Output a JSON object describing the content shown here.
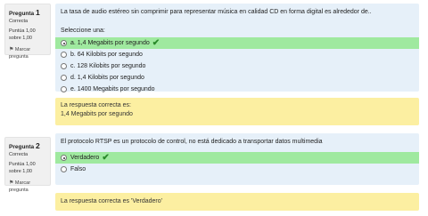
{
  "questions": [
    {
      "label": "Pregunta",
      "number": "1",
      "state": "Correcta",
      "grade": "Puntúa 1,00 sobre 1,00",
      "flag_label": "Marcar pregunta",
      "text": "La tasa de audio estéreo sin comprimir para representar música en calidad CD en forma digital es alrededor de..",
      "prompt": "Seleccione una:",
      "answers": [
        {
          "text": "a. 1,4 Megabits por segundo",
          "selected": true,
          "correct": true
        },
        {
          "text": "b. 64 Kilobits por segundo"
        },
        {
          "text": "c. 128 Kilobits por segundo"
        },
        {
          "text": "d. 1,4 Kilobits por segundo"
        },
        {
          "text": "e. 1400 Megabits por segundo"
        }
      ],
      "feedback_title": "La respuesta correcta es:",
      "feedback_answer": "1,4 Megabits por segundo"
    },
    {
      "label": "Pregunta",
      "number": "2",
      "state": "Correcta",
      "grade": "Puntúa 1,00 sobre 1,00",
      "flag_label": "Marcar pregunta",
      "text": "El protocolo RTSP es un protocolo de control, no está dedicado a transportar datos multimedia",
      "answers": [
        {
          "text": "Verdadero",
          "selected": true,
          "correct": true
        },
        {
          "text": "Falso"
        }
      ],
      "feedback_title": "La respuesta correcta es 'Verdadero'"
    }
  ],
  "icons": {
    "flag": "flag-icon",
    "correct": "check-icon"
  },
  "colors": {
    "question_bg": "#e6f0f9",
    "feedback_bg": "#fcefa1",
    "correct_bg": "#9fe99f",
    "info_bg": "#f0f0f0"
  }
}
